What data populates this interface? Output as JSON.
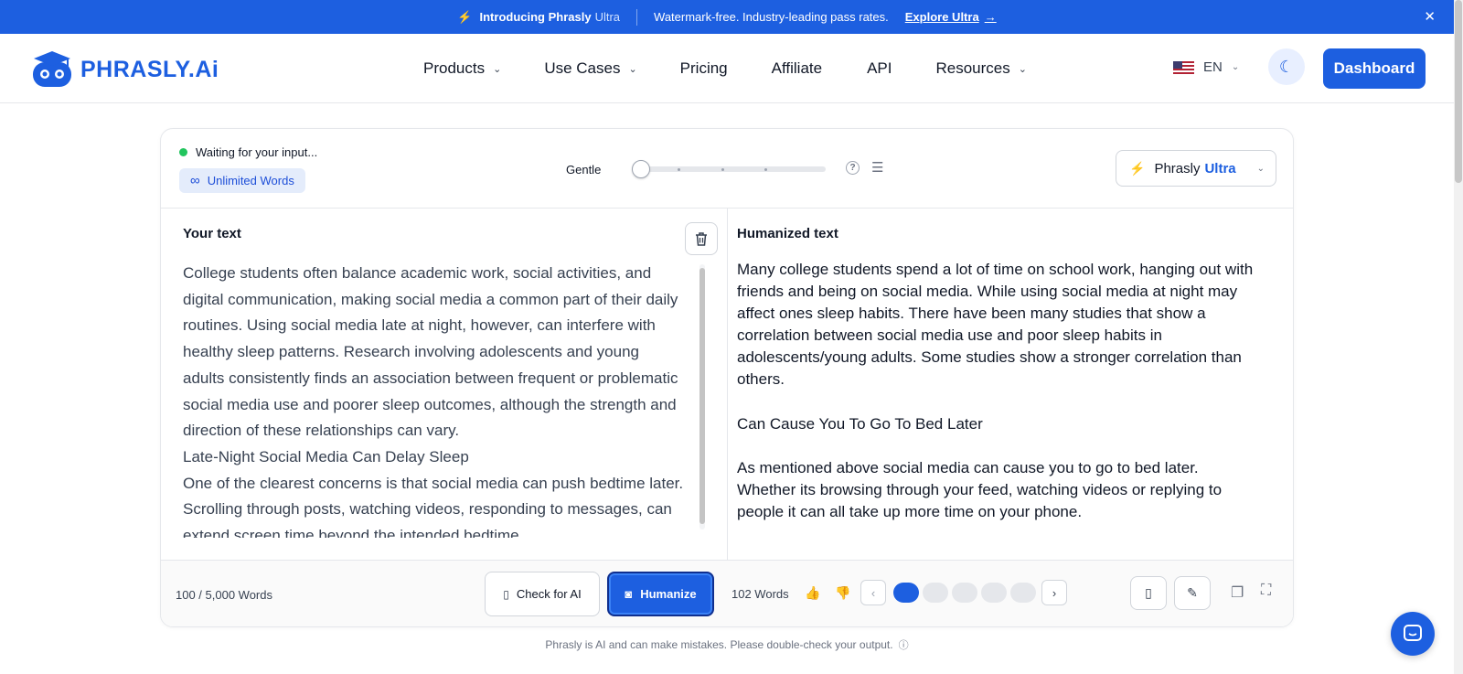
{
  "announcement": {
    "intro": "Introducing Phrasly",
    "intro_ultra": "Ultra",
    "tagline": "Watermark-free. Industry-leading pass rates.",
    "cta": "Explore Ultra",
    "arrow": "→",
    "close": "✕"
  },
  "header": {
    "logo_text": "PHRASLY.Ai",
    "nav": [
      {
        "label": "Products",
        "has_dropdown": true
      },
      {
        "label": "Use Cases",
        "has_dropdown": true
      },
      {
        "label": "Pricing",
        "has_dropdown": false
      },
      {
        "label": "Affiliate",
        "has_dropdown": false
      },
      {
        "label": "API",
        "has_dropdown": false
      },
      {
        "label": "Resources",
        "has_dropdown": true
      }
    ],
    "language": "EN",
    "dashboard_label": "Dashboard"
  },
  "toolbar": {
    "status": "Waiting for your input...",
    "unlimited_label": "Unlimited Words",
    "mode_label": "Gentle",
    "mode_level": 0,
    "model_name": "Phrasly",
    "model_tier": "Ultra"
  },
  "input_panel": {
    "label": "Your text",
    "paragraphs": [
      "College students often balance academic work, social activities, and digital communication, making social media a common part of their daily routines. Using social media late at night, however, can interfere with healthy sleep patterns. Research involving adolescents and young adults consistently finds an association between frequent or problematic social media use and poorer sleep outcomes, although the strength and direction of these relationships can vary.",
      "Late-Night Social Media Can Delay Sleep",
      "One of the clearest concerns is that social media can push bedtime later. Scrolling through posts, watching videos, responding to messages, can extend screen time beyond the intended bedtime."
    ],
    "word_count": "100 / 5,000 Words",
    "check_label": "Check for AI",
    "humanize_label": "Humanize"
  },
  "output_panel": {
    "label": "Humanized text",
    "paragraphs": [
      "Many college students spend a lot of time on school work, hanging out with friends and being on social media. While using social media at night may affect ones sleep habits. There have been many studies that show a correlation between social media use and poor sleep habits in adolescents/young adults. Some studies show a stronger correlation than others.",
      "Can Cause You To Go To Bed Later",
      "As mentioned above social media can cause you to go to bed later. Whether its browsing through your feed, watching videos or replying to people it can all take up more time on your phone."
    ],
    "word_count": "102 Words",
    "versions": 5,
    "active_version": 1
  },
  "disclaimer": "Phrasly is AI and can make mistakes. Please double-check your output.",
  "colors": {
    "brand": "#1d5fe0",
    "status_green": "#22c55e"
  }
}
